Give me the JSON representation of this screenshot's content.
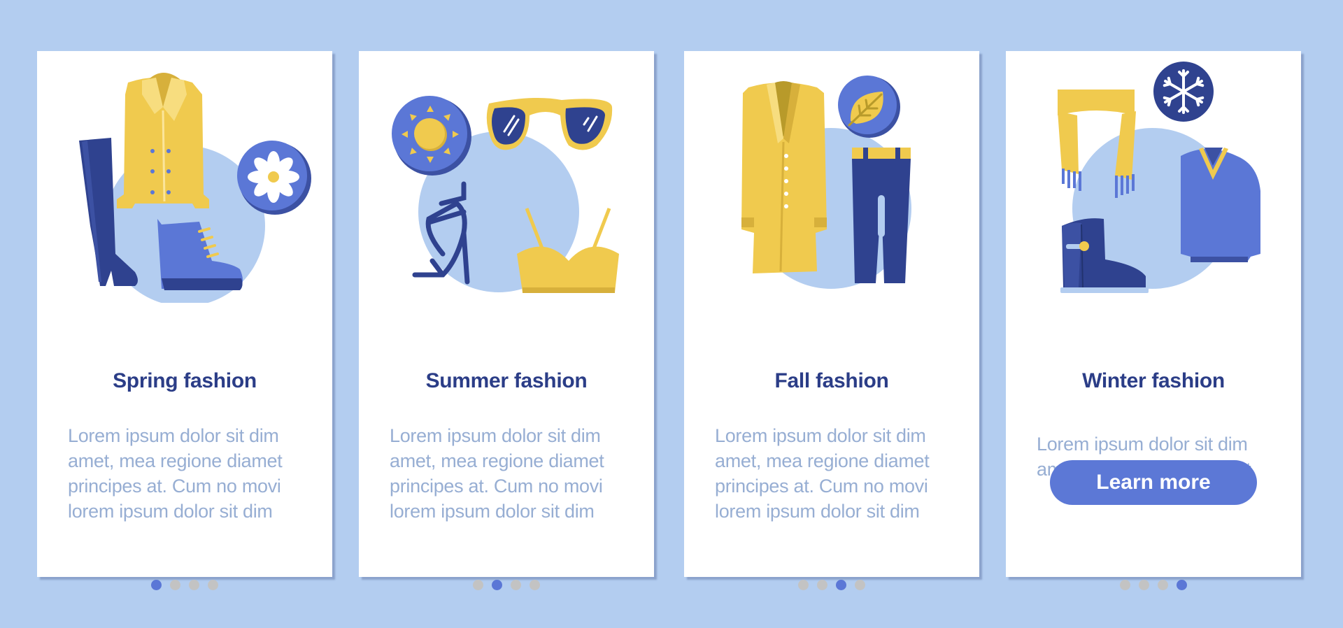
{
  "colors": {
    "background": "#b3cdf0",
    "title": "#2b3d87",
    "body_text": "#97aed3",
    "accent": "#5b77d6",
    "dot_inactive": "#c3c3c3",
    "yellow": "#f0ca4e",
    "navy": "#2f428f",
    "blob": "#b3cdf0"
  },
  "cards": [
    {
      "id": "spring",
      "title": "Spring fashion",
      "body_lines": [
        "Lorem ipsum dolor sit dim",
        "amet, mea regione diamet",
        "principes at. Cum no movi",
        "lorem ipsum dolor sit dim"
      ],
      "icons": [
        "tall-boot-icon",
        "pea-coat-icon",
        "ankle-boot-icon",
        "daisy-badge-icon"
      ],
      "active_page": 1,
      "page_count": 4
    },
    {
      "id": "summer",
      "title": "Summer fashion",
      "body_lines": [
        "Lorem ipsum dolor sit dim",
        "amet, mea regione diamet",
        "principes at. Cum no movi",
        "lorem ipsum dolor sit dim"
      ],
      "icons": [
        "sun-badge-icon",
        "sunglasses-icon",
        "strappy-heel-icon",
        "crop-top-icon"
      ],
      "active_page": 2,
      "page_count": 4
    },
    {
      "id": "fall",
      "title": "Fall fashion",
      "body_lines": [
        "Lorem ipsum dolor sit dim",
        "amet, mea regione diamet",
        "principes at. Cum no movi",
        "lorem ipsum dolor sit dim"
      ],
      "icons": [
        "trench-coat-icon",
        "leaf-badge-icon",
        "jeans-icon"
      ],
      "active_page": 3,
      "page_count": 4
    },
    {
      "id": "winter",
      "title": "Winter fashion",
      "body_lines": [
        "Lorem ipsum dolor sit dim",
        "amet, mea regione diamet"
      ],
      "icons": [
        "scarf-icon",
        "snowflake-badge-icon",
        "sweater-icon",
        "ugg-boot-icon"
      ],
      "button_label": "Learn more",
      "active_page": 4,
      "page_count": 4
    }
  ]
}
